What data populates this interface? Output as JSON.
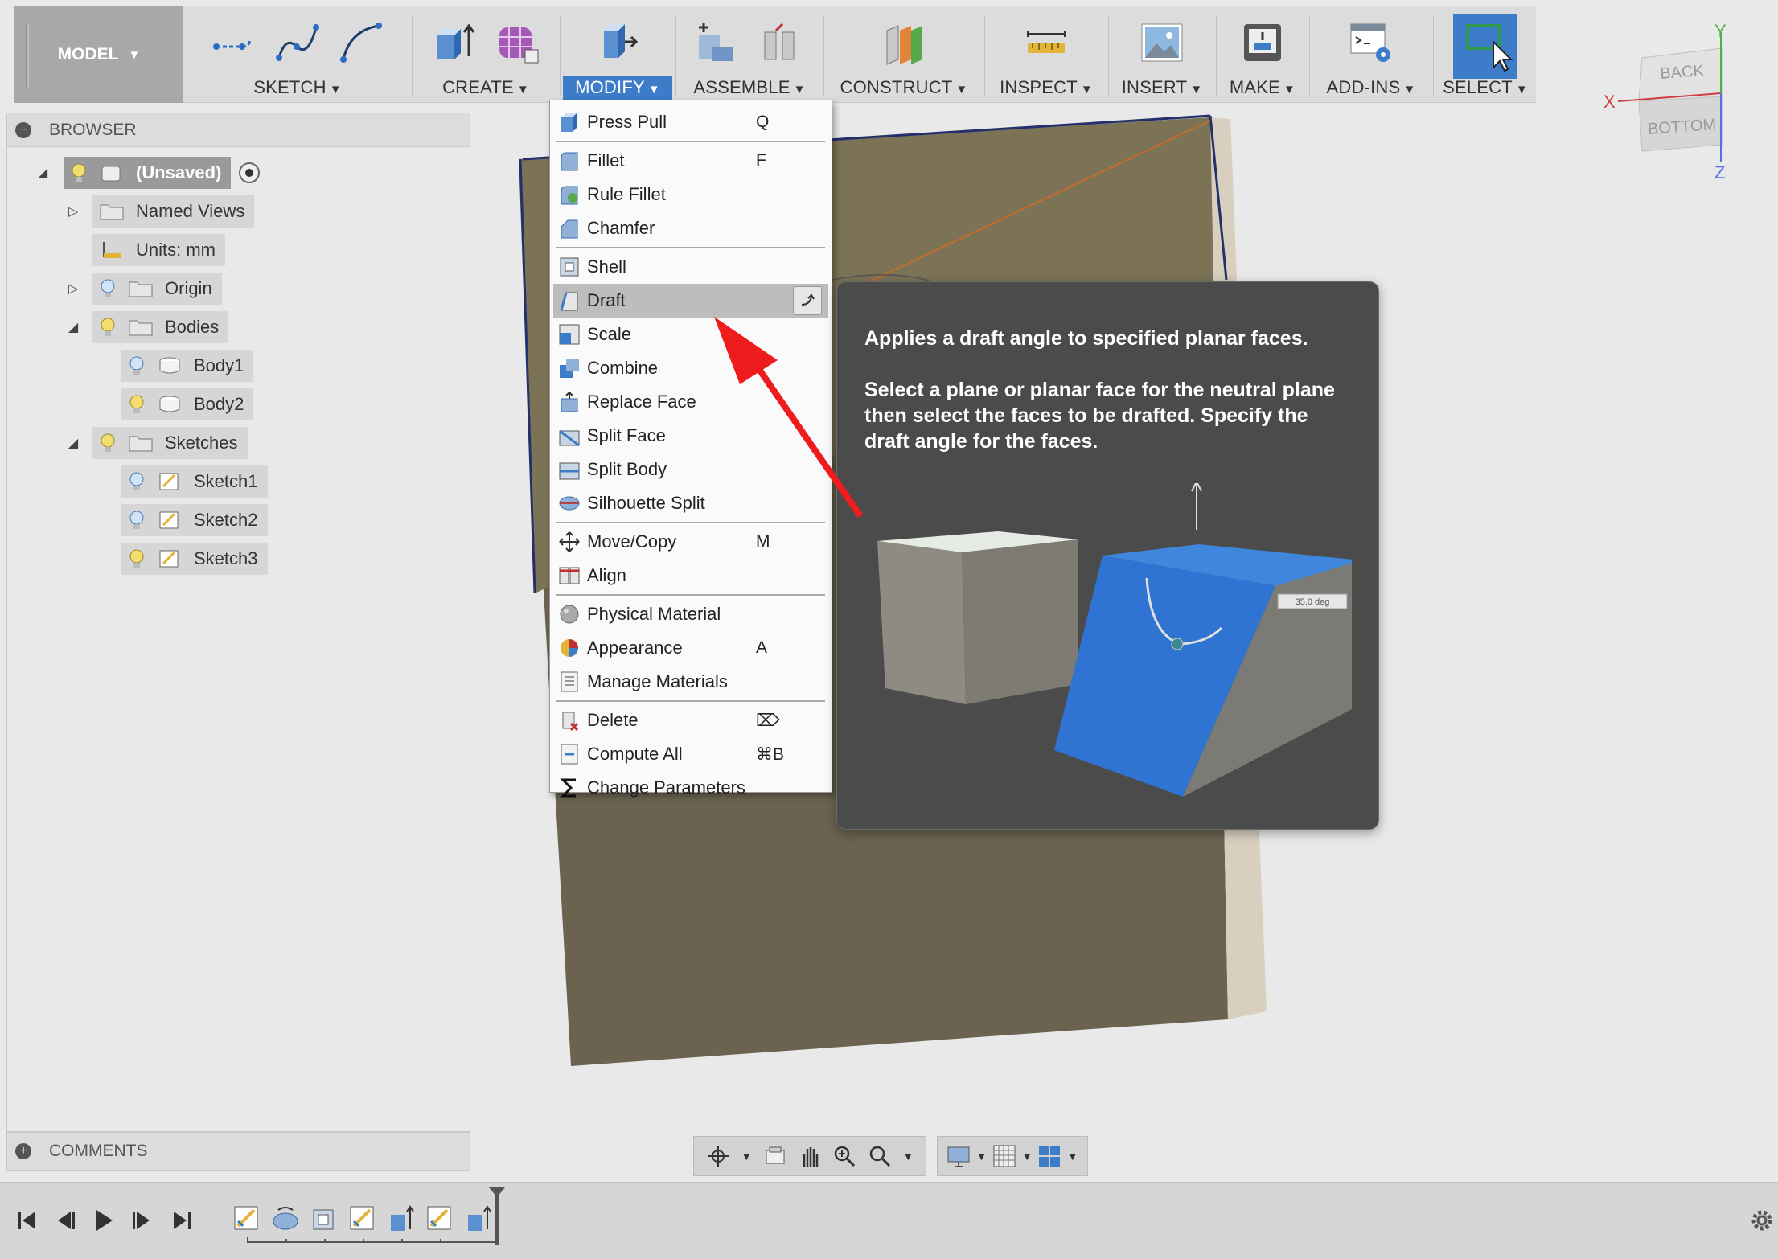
{
  "toolbar": {
    "workspace": "MODEL",
    "groups": [
      {
        "label": "SKETCH"
      },
      {
        "label": "CREATE"
      },
      {
        "label": "MODIFY"
      },
      {
        "label": "ASSEMBLE"
      },
      {
        "label": "CONSTRUCT"
      },
      {
        "label": "INSPECT"
      },
      {
        "label": "INSERT"
      },
      {
        "label": "MAKE"
      },
      {
        "label": "ADD-INS"
      },
      {
        "label": "SELECT"
      }
    ],
    "accent": "#3d7cc9"
  },
  "browser": {
    "title": "BROWSER",
    "root": "(Unsaved)",
    "items": [
      {
        "label": "Named Views"
      },
      {
        "label": "Units: mm"
      },
      {
        "label": "Origin"
      },
      {
        "label": "Bodies"
      },
      {
        "label": "Body1"
      },
      {
        "label": "Body2"
      },
      {
        "label": "Sketches"
      },
      {
        "label": "Sketch1"
      },
      {
        "label": "Sketch2"
      },
      {
        "label": "Sketch3"
      }
    ]
  },
  "comments": {
    "title": "COMMENTS"
  },
  "viewcube": {
    "back": "BACK",
    "bottom": "BOTTOM",
    "x": "X",
    "y": "Y",
    "z": "Z"
  },
  "modify_menu": {
    "items": [
      {
        "label": "Press Pull",
        "shortcut": "Q"
      },
      {
        "label": "Fillet",
        "shortcut": "F"
      },
      {
        "label": "Rule Fillet",
        "shortcut": ""
      },
      {
        "label": "Chamfer",
        "shortcut": ""
      },
      {
        "label": "Shell",
        "shortcut": ""
      },
      {
        "label": "Draft",
        "shortcut": ""
      },
      {
        "label": "Scale",
        "shortcut": ""
      },
      {
        "label": "Combine",
        "shortcut": ""
      },
      {
        "label": "Replace Face",
        "shortcut": ""
      },
      {
        "label": "Split Face",
        "shortcut": ""
      },
      {
        "label": "Split Body",
        "shortcut": ""
      },
      {
        "label": "Silhouette Split",
        "shortcut": ""
      },
      {
        "label": "Move/Copy",
        "shortcut": "M"
      },
      {
        "label": "Align",
        "shortcut": ""
      },
      {
        "label": "Physical Material",
        "shortcut": ""
      },
      {
        "label": "Appearance",
        "shortcut": "A"
      },
      {
        "label": "Manage Materials",
        "shortcut": ""
      },
      {
        "label": "Delete",
        "shortcut": "⌦"
      },
      {
        "label": "Compute All",
        "shortcut": "⌘B"
      },
      {
        "label": "Change Parameters",
        "shortcut": ""
      }
    ]
  },
  "tooltip": {
    "line1": "Applies a draft angle to specified planar faces.",
    "line2": "Select a plane or planar face for the neutral plane then select the faces to be drafted. Specify the draft angle for the faces.",
    "angle_label": "35.0 deg"
  }
}
